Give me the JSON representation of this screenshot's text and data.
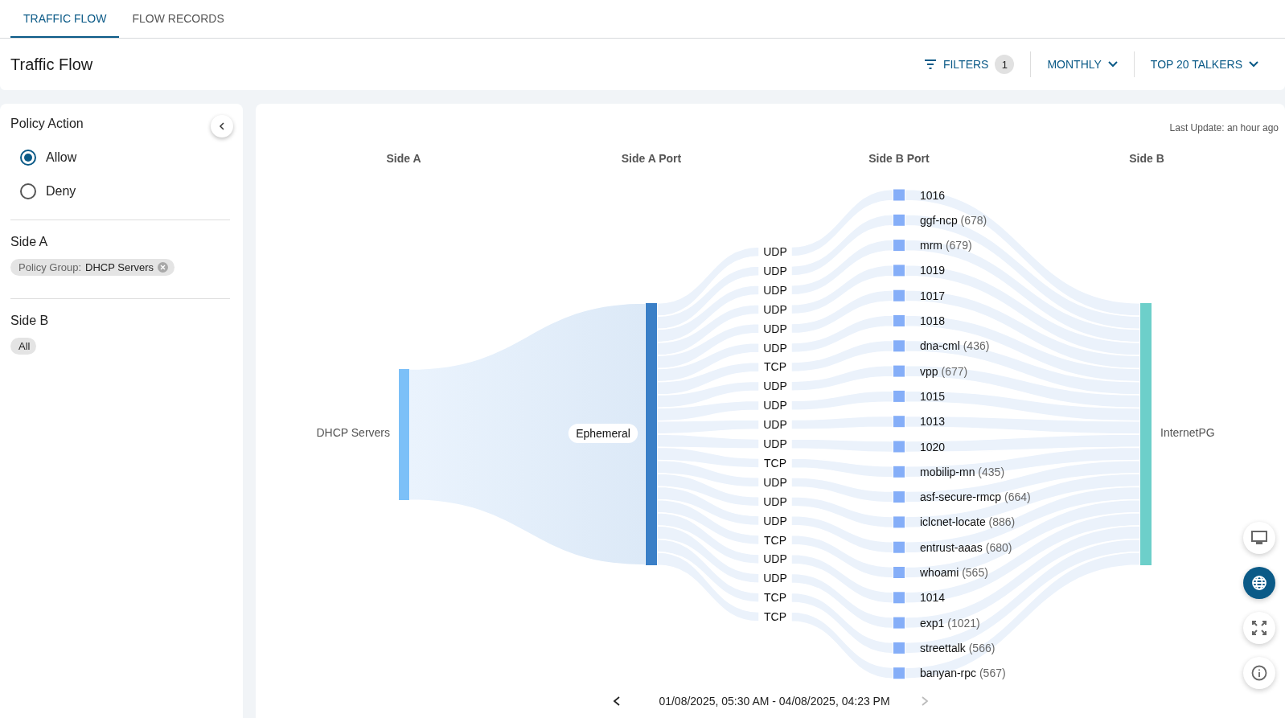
{
  "tabs": [
    {
      "label": "TRAFFIC FLOW",
      "selected": true
    },
    {
      "label": "FLOW RECORDS",
      "selected": false
    }
  ],
  "page_title": "Traffic Flow",
  "toolbar": {
    "filters": "FILTERS",
    "filter_count": "1",
    "period": "MONTHLY",
    "talkers": "TOP 20 TALKERS"
  },
  "sidebar": {
    "policy_action": {
      "title": "Policy Action",
      "options": [
        {
          "label": "Allow",
          "selected": true
        },
        {
          "label": "Deny",
          "selected": false
        }
      ]
    },
    "side_a": {
      "title": "Side A",
      "chip_prefix": "Policy Group:",
      "chip_value": "DHCP Servers"
    },
    "side_b": {
      "title": "Side B",
      "chip": "All"
    }
  },
  "sankey": {
    "last_update": "Last Update: an hour ago",
    "columns": [
      "Side A",
      "Side A Port",
      "Side B Port",
      "Side B"
    ],
    "side_a": "DHCP Servers",
    "side_a_port": "Ephemeral",
    "side_b": "InternetPG",
    "protocols": [
      "UDP",
      "UDP",
      "UDP",
      "UDP",
      "UDP",
      "UDP",
      "TCP",
      "UDP",
      "UDP",
      "UDP",
      "UDP",
      "TCP",
      "UDP",
      "UDP",
      "UDP",
      "TCP",
      "UDP",
      "UDP",
      "TCP",
      "TCP"
    ],
    "side_b_ports": [
      {
        "name": "1016"
      },
      {
        "name": "ggf-ncp",
        "number": "(678)"
      },
      {
        "name": "mrm",
        "number": "(679)"
      },
      {
        "name": "1019"
      },
      {
        "name": "1017"
      },
      {
        "name": "1018"
      },
      {
        "name": "dna-cml",
        "number": "(436)"
      },
      {
        "name": "vpp",
        "number": "(677)"
      },
      {
        "name": "1015"
      },
      {
        "name": "1013"
      },
      {
        "name": "1020"
      },
      {
        "name": "mobilip-mn",
        "number": "(435)"
      },
      {
        "name": "asf-secure-rmcp",
        "number": "(664)"
      },
      {
        "name": "iclcnet-locate",
        "number": "(886)"
      },
      {
        "name": "entrust-aaas",
        "number": "(680)"
      },
      {
        "name": "whoami",
        "number": "(565)"
      },
      {
        "name": "1014"
      },
      {
        "name": "exp1",
        "number": "(1021)"
      },
      {
        "name": "streettalk",
        "number": "(566)"
      },
      {
        "name": "banyan-rpc",
        "number": "(567)"
      }
    ],
    "date_range": "01/08/2025, 05:30 AM - 04/08/2025, 04:23 PM"
  },
  "view_buttons": [
    {
      "kind": "monitor",
      "selected": false
    },
    {
      "kind": "globe",
      "selected": true
    },
    {
      "kind": "fullscreen",
      "selected": false
    },
    {
      "kind": "info",
      "selected": false
    }
  ]
}
